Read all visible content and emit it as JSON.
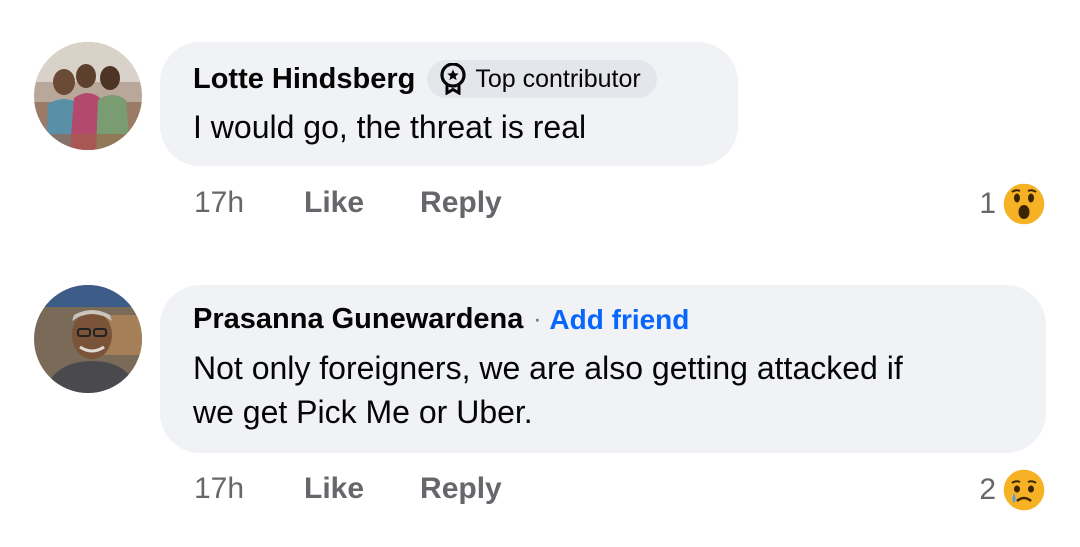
{
  "comments": [
    {
      "author": "Lotte Hindsberg",
      "badge": "Top contributor",
      "text": "I would go, the threat is real",
      "time": "17h",
      "like_label": "Like",
      "reply_label": "Reply",
      "reaction_count": "1",
      "reaction_icon": "wow-reaction-icon"
    },
    {
      "author": "Prasanna Gunewardena",
      "separator": "·",
      "add_friend_label": "Add friend",
      "text_lines": [
        "Not only foreigners, we are also getting attacked if",
        "we get Pick Me or Uber."
      ],
      "time": "17h",
      "like_label": "Like",
      "reply_label": "Reply",
      "reaction_count": "2",
      "reaction_icon": "sad-reaction-icon"
    }
  ],
  "colors": {
    "bubble": "#f0f2f5",
    "badge": "#e4e6eb",
    "meta_text": "#65676b",
    "link": "#0866ff",
    "reaction": "#f7b125"
  }
}
